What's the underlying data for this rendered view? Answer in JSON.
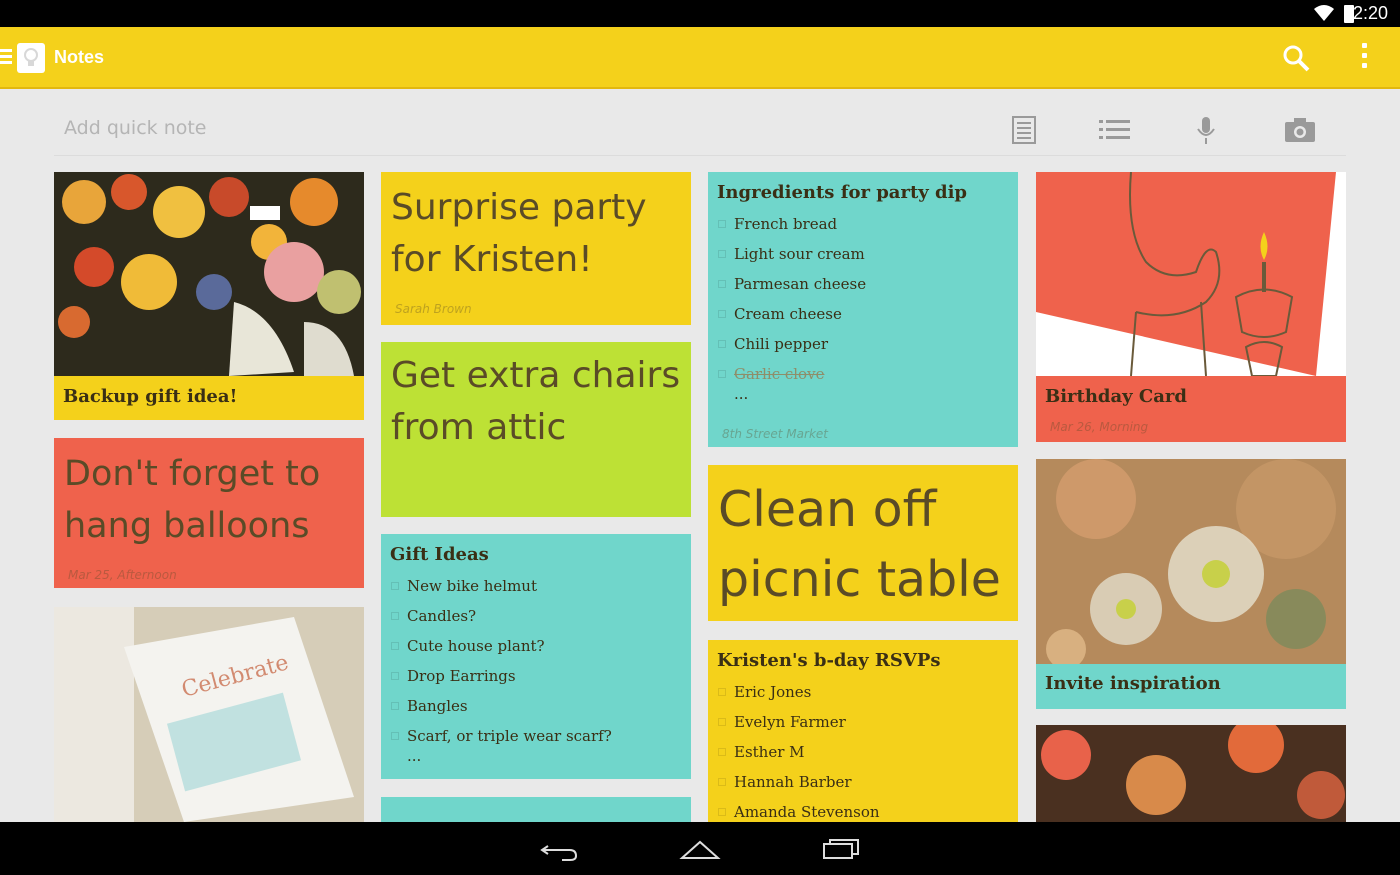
{
  "status_bar": {
    "time": "2:20"
  },
  "action_bar": {
    "title": "Notes"
  },
  "quick_note": {
    "placeholder": "Add quick note"
  },
  "notes": {
    "backup_gift": {
      "title": "Backup gift idea!"
    },
    "dont_forget": {
      "text": "Don't forget to hang balloons",
      "meta": "Mar 25, Afternoon"
    },
    "surprise_party": {
      "text": "Surprise party for Kristen!",
      "meta": "Sarah Brown"
    },
    "extra_chairs": {
      "text": "Get extra chairs from attic"
    },
    "gift_ideas": {
      "title": "Gift Ideas",
      "items": [
        "New bike helmut",
        "Candles?",
        "Cute house plant?",
        "Drop Earrings",
        "Bangles",
        "Scarf, or triple wear scarf?"
      ],
      "more": "..."
    },
    "party_dip": {
      "title": "Ingredients for party dip",
      "items": [
        "French bread",
        "Light  sour cream",
        "Parmesan cheese",
        "Cream cheese",
        "Chili pepper"
      ],
      "done_item": "Garlic clove",
      "more": "...",
      "meta": "8th Street Market"
    },
    "clean_off": {
      "text": "Clean off picnic table"
    },
    "rsvps": {
      "title": "Kristen's b-day RSVPs",
      "items": [
        "Eric Jones",
        "Evelyn Farmer",
        "Esther M",
        "Hannah Barber",
        "Amanda Stevenson"
      ]
    },
    "birthday_card": {
      "title": "Birthday Card",
      "meta": "Mar 26, Morning"
    },
    "invite_inspiration": {
      "title": "Invite inspiration"
    }
  },
  "colors": {
    "yellow": "#f4d11b",
    "green": "#bde135",
    "teal": "#70d6cb",
    "red": "#ef624c"
  }
}
